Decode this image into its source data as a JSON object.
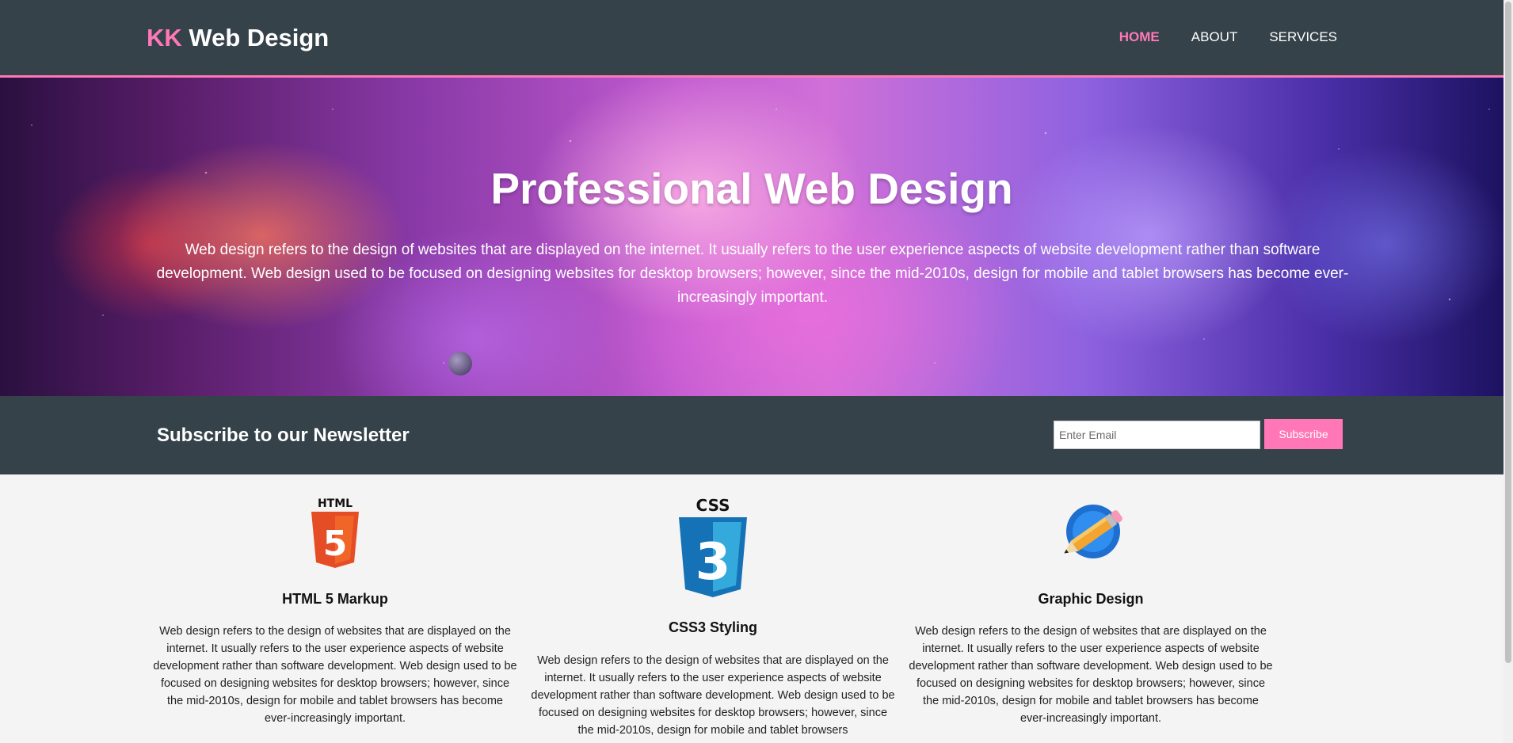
{
  "header": {
    "logo_highlight": "KK",
    "logo_rest": " Web Design",
    "nav": [
      {
        "label": "HOME",
        "active": true
      },
      {
        "label": "ABOUT",
        "active": false
      },
      {
        "label": "SERVICES",
        "active": false
      }
    ]
  },
  "showcase": {
    "title": "Professional Web Design",
    "text": "Web design refers to the design of websites that are displayed on the internet. It usually refers to the user experience aspects of website development rather than software development. Web design used to be focused on designing websites for desktop browsers; however, since the mid-2010s, design for mobile and tablet browsers has become ever-increasingly important."
  },
  "newsletter": {
    "heading": "Subscribe to our Newsletter",
    "email_placeholder": "Enter Email",
    "email_value": "",
    "button_label": "Subscribe"
  },
  "boxes": [
    {
      "icon": "html5-logo-icon",
      "icon_text": "HTML",
      "icon_number": "5",
      "title": "HTML 5 Markup",
      "text": "Web design refers to the design of websites that are displayed on the internet. It usually refers to the user experience aspects of website development rather than software development. Web design used to be focused on designing websites for desktop browsers; however, since the mid-2010s, design for mobile and tablet browsers has become ever-increasingly important."
    },
    {
      "icon": "css3-logo-icon",
      "icon_text": "CSS",
      "icon_number": "3",
      "title": "CSS3 Styling",
      "text": "Web design refers to the design of websites that are displayed on the internet. It usually refers to the user experience aspects of website development rather than software development. Web design used to be focused on designing websites for desktop browsers; however, since the mid-2010s, design for mobile and tablet browsers"
    },
    {
      "icon": "pencil-graphic-icon",
      "title": "Graphic Design",
      "text": "Web design refers to the design of websites that are displayed on the internet. It usually refers to the user experience aspects of website development rather than software development. Web design used to be focused on designing websites for desktop browsers; however, since the mid-2010s, design for mobile and tablet browsers has become ever-increasingly important."
    }
  ],
  "colors": {
    "header_bg": "#35424a",
    "accent": "#ff77b6",
    "body_bg": "#f4f4f4"
  }
}
